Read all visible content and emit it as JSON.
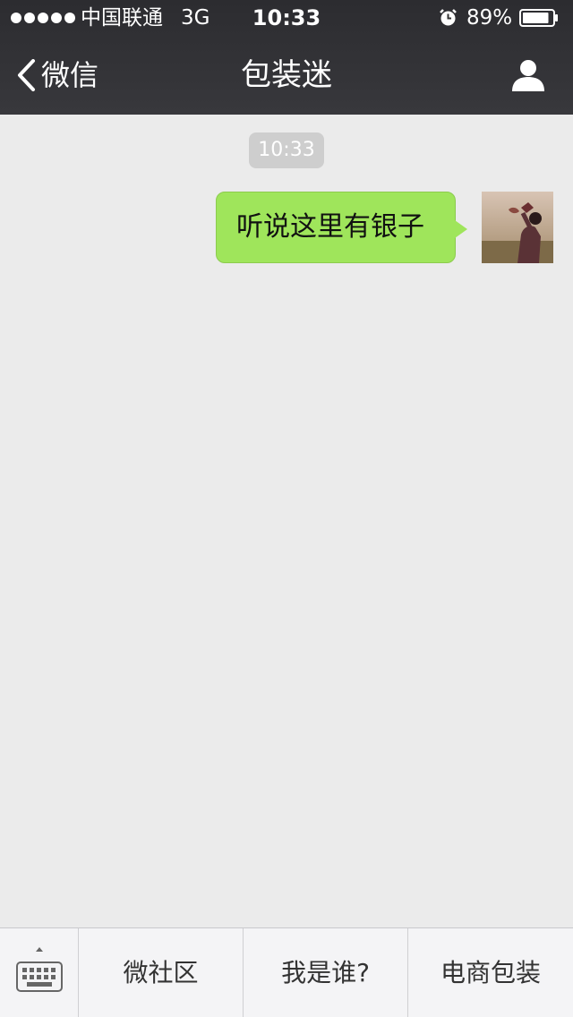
{
  "status_bar": {
    "carrier": "中国联通",
    "network": "3G",
    "time": "10:33",
    "battery_percent": "89%",
    "signal_dots": 5,
    "battery_level": 0.89,
    "icons": [
      "signal-dots-icon",
      "alarm-clock-icon",
      "battery-icon"
    ]
  },
  "nav": {
    "back_label": "微信",
    "title": "包装迷",
    "icons": [
      "back-chevron-icon",
      "person-icon"
    ]
  },
  "chat": {
    "timestamp": "10:33",
    "messages": [
      {
        "sender": "self",
        "text": "听说这里有银子"
      }
    ]
  },
  "bottom_menu": {
    "keyboard_icon": "keyboard-icon",
    "items": [
      {
        "label": "微社区"
      },
      {
        "label": "我是谁?"
      },
      {
        "label": "电商包装"
      }
    ]
  },
  "colors": {
    "header_bg": "#333337",
    "chat_bg": "#ebebeb",
    "bubble_green": "#9fe55b",
    "time_badge_bg": "#cecece",
    "bottom_bar_bg": "#f4f4f6"
  }
}
